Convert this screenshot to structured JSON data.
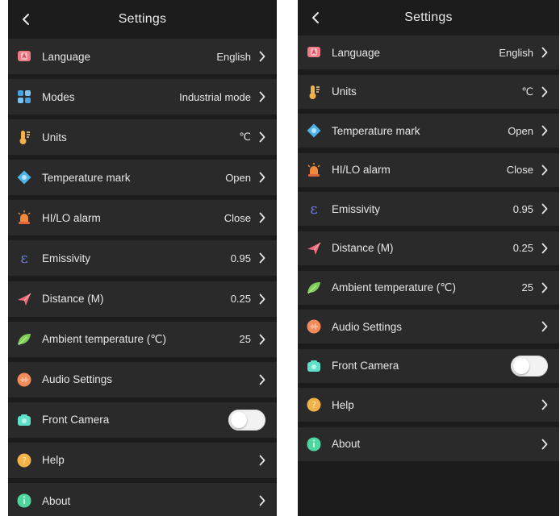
{
  "colors": {
    "background": "#1c1c1c",
    "row": "#2a2a2a",
    "text": "#e6e6e6",
    "language_icon": "#ef7b86",
    "modes_icon": "#4aa3e0",
    "units_icon": "#f2b24a",
    "temperature_mark_icon": "#4fb3e8",
    "alarm_icon": "#f0883e",
    "emissivity_icon": "#6f7fe0",
    "distance_icon": "#f06a7a",
    "ambient_icon": "#7fce5a",
    "audio_icon": "#f28a5a",
    "camera_icon": "#5fe0c8",
    "help_icon": "#f2b24a",
    "about_icon": "#4fd6a0"
  },
  "left_screen": {
    "title": "Settings",
    "rows": [
      {
        "label": "Language",
        "value": "English",
        "icon": "language-icon"
      },
      {
        "label": "Modes",
        "value": "Industrial mode",
        "icon": "modes-icon"
      },
      {
        "label": "Units",
        "value": "℃",
        "icon": "thermometer-icon"
      },
      {
        "label": "Temperature mark",
        "value": "Open",
        "icon": "temperature-mark-icon"
      },
      {
        "label": "HI/LO alarm",
        "value": "Close",
        "icon": "alarm-icon"
      },
      {
        "label": "Emissivity",
        "value": "0.95",
        "icon": "emissivity-icon"
      },
      {
        "label": "Distance (M)",
        "value": "0.25",
        "icon": "distance-icon"
      },
      {
        "label": "Ambient temperature (℃)",
        "value": "25",
        "icon": "leaf-icon"
      },
      {
        "label": "Audio Settings",
        "value": "",
        "icon": "audio-icon"
      },
      {
        "label": "Front Camera",
        "value": "",
        "icon": "camera-icon",
        "toggle": "off"
      },
      {
        "label": "Help",
        "value": "",
        "icon": "help-icon"
      },
      {
        "label": "About",
        "value": "",
        "icon": "about-icon"
      }
    ]
  },
  "right_screen": {
    "title": "Settings",
    "rows": [
      {
        "label": "Language",
        "value": "English",
        "icon": "language-icon"
      },
      {
        "label": "Units",
        "value": "℃",
        "icon": "thermometer-icon"
      },
      {
        "label": "Temperature mark",
        "value": "Open",
        "icon": "temperature-mark-icon"
      },
      {
        "label": "HI/LO alarm",
        "value": "Close",
        "icon": "alarm-icon"
      },
      {
        "label": "Emissivity",
        "value": "0.95",
        "icon": "emissivity-icon"
      },
      {
        "label": "Distance (M)",
        "value": "0.25",
        "icon": "distance-icon"
      },
      {
        "label": "Ambient temperature (℃)",
        "value": "25",
        "icon": "leaf-icon"
      },
      {
        "label": "Audio Settings",
        "value": "",
        "icon": "audio-icon"
      },
      {
        "label": "Front Camera",
        "value": "",
        "icon": "camera-icon",
        "toggle": "off"
      },
      {
        "label": "Help",
        "value": "",
        "icon": "help-icon"
      },
      {
        "label": "About",
        "value": "",
        "icon": "about-icon"
      }
    ]
  }
}
